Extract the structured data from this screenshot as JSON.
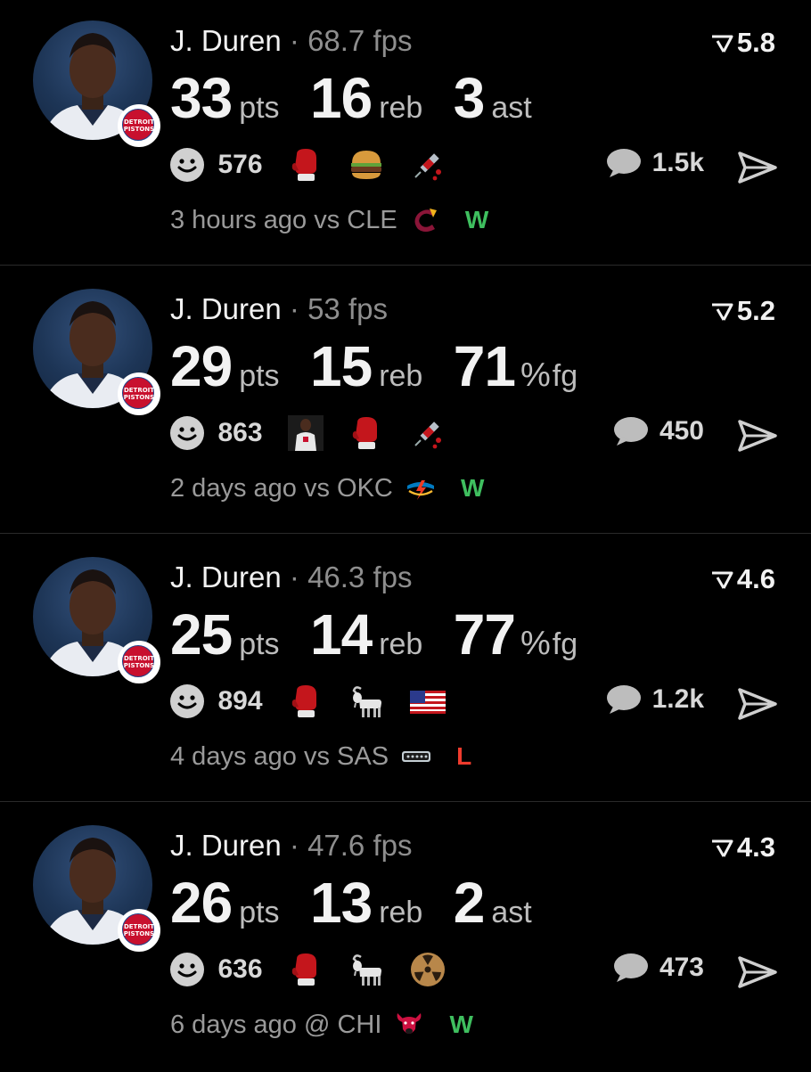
{
  "colors": {
    "win": "#3fbf5f",
    "loss": "#ef3b2d",
    "background": "#000000"
  },
  "games": [
    {
      "player": "J. Duren",
      "fps": "68.7 fps",
      "rating": "5.8",
      "stats": [
        {
          "value": "33",
          "unit": "pts"
        },
        {
          "value": "16",
          "unit": "reb"
        },
        {
          "value": "3",
          "unit": "ast"
        }
      ],
      "likes": "576",
      "reactions": [
        "boxing-glove-icon",
        "burger-icon",
        "syringe-icon"
      ],
      "comments": "1.5k",
      "time": "3 hours ago",
      "matchup": "vs CLE",
      "opponent_icon": "cavaliers-logo-icon",
      "result": "W"
    },
    {
      "player": "J. Duren",
      "fps": "53 fps",
      "rating": "5.2",
      "stats": [
        {
          "value": "29",
          "unit": "pts"
        },
        {
          "value": "15",
          "unit": "reb"
        },
        {
          "value": "71",
          "pct": "%",
          "unit": "fg"
        }
      ],
      "likes": "863",
      "reactions": [
        "player-photo-icon",
        "boxing-glove-icon",
        "syringe-icon"
      ],
      "comments": "450",
      "time": "2 days ago",
      "matchup": "vs OKC",
      "opponent_icon": "thunder-logo-icon",
      "result": "W"
    },
    {
      "player": "J. Duren",
      "fps": "46.3 fps",
      "rating": "4.6",
      "stats": [
        {
          "value": "25",
          "unit": "pts"
        },
        {
          "value": "14",
          "unit": "reb"
        },
        {
          "value": "77",
          "pct": "%",
          "unit": "fg"
        }
      ],
      "likes": "894",
      "reactions": [
        "boxing-glove-icon",
        "goat-icon",
        "us-flag-icon"
      ],
      "comments": "1.2k",
      "time": "4 days ago",
      "matchup": "vs SAS",
      "opponent_icon": "spurs-logo-icon",
      "result": "L"
    },
    {
      "player": "J. Duren",
      "fps": "47.6 fps",
      "rating": "4.3",
      "stats": [
        {
          "value": "26",
          "unit": "pts"
        },
        {
          "value": "13",
          "unit": "reb"
        },
        {
          "value": "2",
          "unit": "ast"
        }
      ],
      "likes": "636",
      "reactions": [
        "boxing-glove-icon",
        "goat-icon",
        "radioactive-icon"
      ],
      "comments": "473",
      "time": "6 days ago",
      "matchup": "@ CHI",
      "opponent_icon": "bulls-logo-icon",
      "result": "W"
    }
  ],
  "team_badge_text": "DETROIT PISTONS"
}
